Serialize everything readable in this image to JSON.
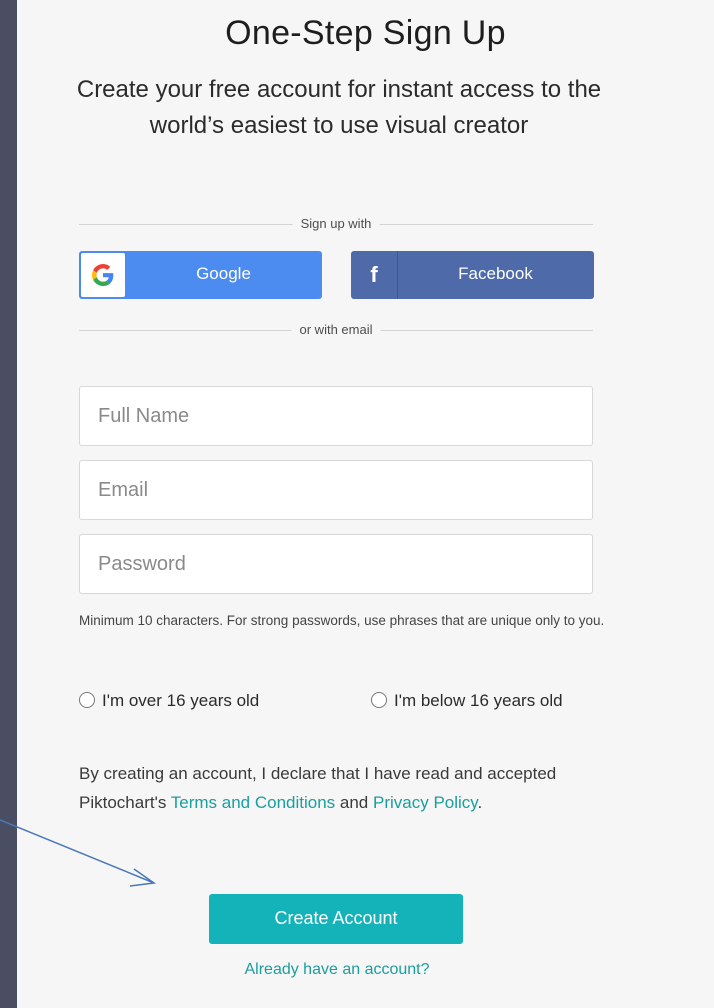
{
  "header": {
    "title": "One-Step Sign Up",
    "subtitle": "Create your free account for instant access to the world’s easiest to use visual creator"
  },
  "social": {
    "divider_label": "Sign up with",
    "google_label": "Google",
    "facebook_label": "Facebook",
    "facebook_glyph": "f",
    "google_icon": "google-g-icon",
    "facebook_icon": "facebook-f-icon"
  },
  "email_divider_label": "or with email",
  "form": {
    "full_name_placeholder": "Full Name",
    "email_placeholder": "Email",
    "password_placeholder": "Password",
    "password_hint": "Minimum 10 characters. For strong passwords, use phrases that are unique only to you.",
    "age_over_label": "I'm over 16 years old",
    "age_under_label": "I'm below 16 years old"
  },
  "legal": {
    "prefix": "By creating an account, I declare that I have read and accepted Piktochart's ",
    "terms_link": "Terms and Conditions",
    "and": " and ",
    "privacy_link": "Privacy Policy",
    "suffix": "."
  },
  "actions": {
    "create_account_label": "Create Account",
    "already_have_account_label": "Already have an account?"
  },
  "colors": {
    "google": "#4c8bf0",
    "facebook": "#4e6aa9",
    "accent": "#14b3b9",
    "link": "#1a9e9e",
    "frame": "#4a4e63",
    "annotation_arrow": "#4a78b8"
  }
}
